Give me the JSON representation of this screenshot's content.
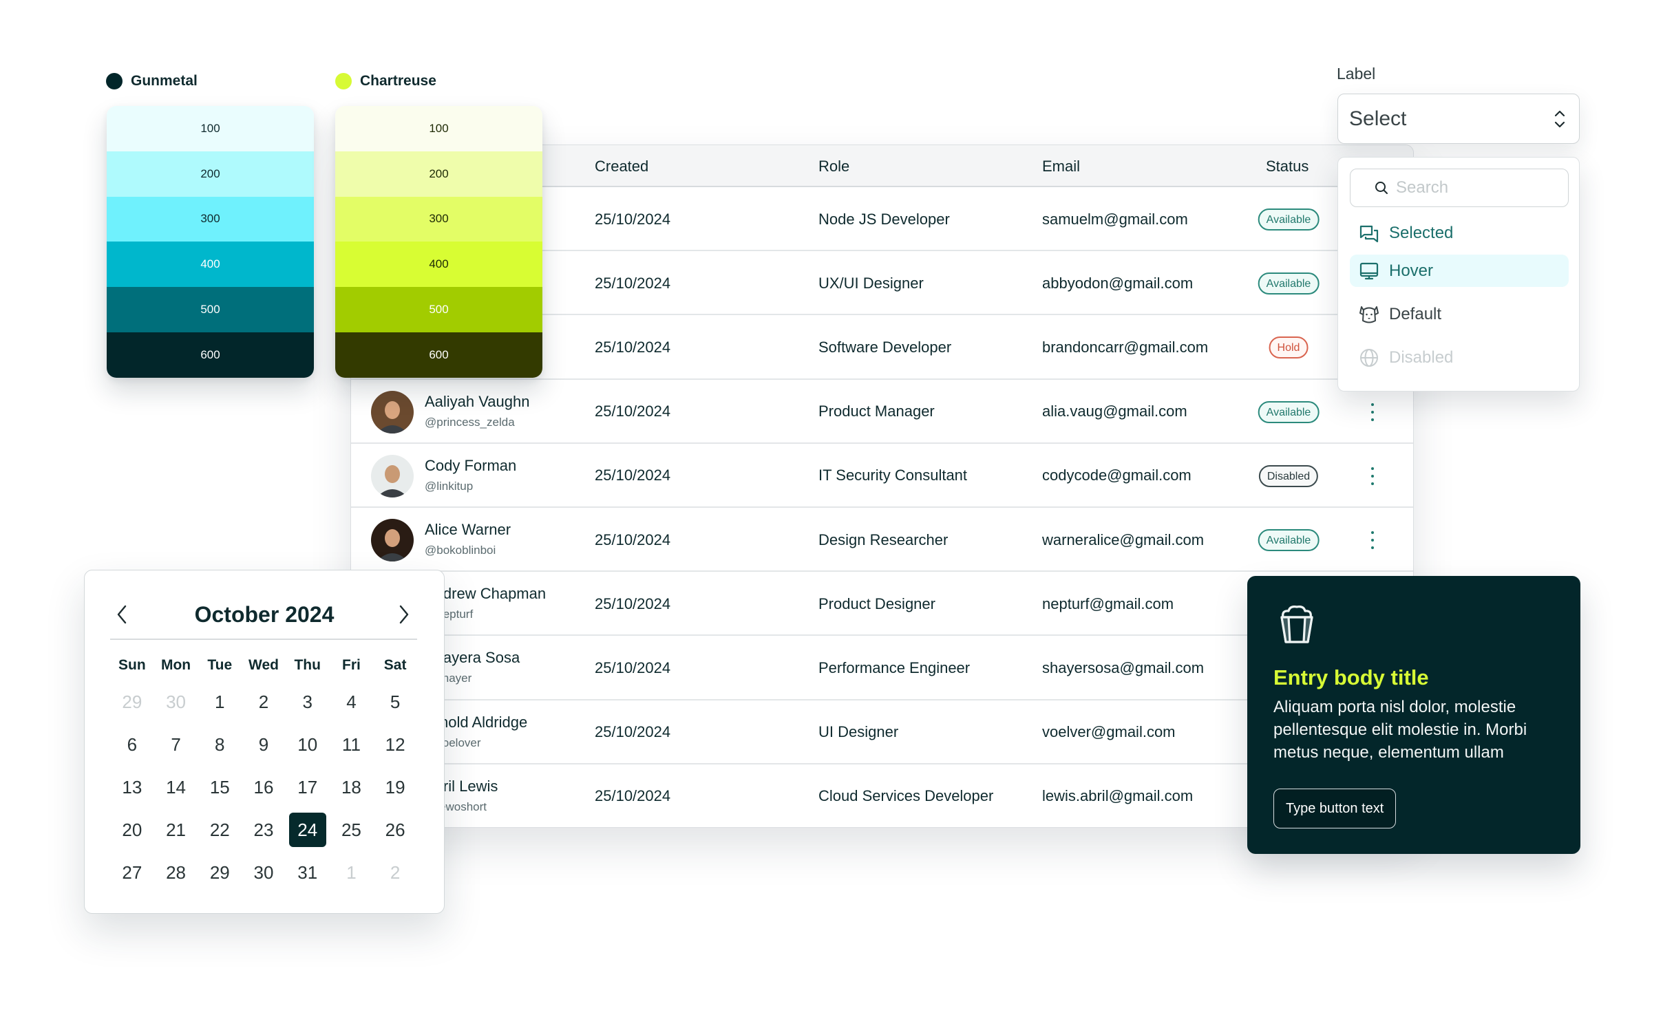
{
  "palettes": [
    {
      "name": "Gunmetal",
      "dot_color": "#02262a",
      "swatches": [
        {
          "label": "100",
          "color": "#eafdfe",
          "text_color": "#0f2a2e"
        },
        {
          "label": "200",
          "color": "#affafd",
          "text_color": "#0f2a2e"
        },
        {
          "label": "300",
          "color": "#6ff1fd",
          "text_color": "#0f2a2e"
        },
        {
          "label": "400",
          "color": "#00b7cc",
          "text_color": "#ffffff"
        },
        {
          "label": "500",
          "color": "#006f7b",
          "text_color": "#ffffff"
        },
        {
          "label": "600",
          "color": "#02262a",
          "text_color": "#ffffff"
        }
      ]
    },
    {
      "name": "Chartreuse",
      "dot_color": "#d7fa35",
      "swatches": [
        {
          "label": "100",
          "color": "#fbfdee",
          "text_color": "#1e2a05"
        },
        {
          "label": "200",
          "color": "#effdab",
          "text_color": "#1e2a05"
        },
        {
          "label": "300",
          "color": "#e3fd66",
          "text_color": "#1e2a05"
        },
        {
          "label": "400",
          "color": "#d8fd33",
          "text_color": "#1e2a05"
        },
        {
          "label": "500",
          "color": "#a2cc00",
          "text_color": "#ffffff"
        },
        {
          "label": "600",
          "color": "#333a00",
          "text_color": "#ffffff"
        }
      ]
    }
  ],
  "table": {
    "columns": {
      "created": "Created",
      "role": "Role",
      "email": "Email",
      "status": "Status"
    },
    "rows": [
      {
        "name": "",
        "handle": "",
        "created": "25/10/2024",
        "role": "Node JS Developer",
        "email": "samuelm@gmail.com",
        "status": "Available",
        "status_kind": "available"
      },
      {
        "name": "",
        "handle": "",
        "created": "25/10/2024",
        "role": "UX/UI Designer",
        "email": "abbyodon@gmail.com",
        "status": "Available",
        "status_kind": "available"
      },
      {
        "name": "",
        "handle": "",
        "created": "25/10/2024",
        "role": "Software Developer",
        "email": "brandoncarr@gmail.com",
        "status": "Hold",
        "status_kind": "hold"
      },
      {
        "name": "Aaliyah Vaughn",
        "handle": "@princess_zelda",
        "created": "25/10/2024",
        "role": "Product Manager",
        "email": "alia.vaug@gmail.com",
        "status": "Available",
        "status_kind": "available",
        "avatar_bg": "#6b4a2f",
        "avatar_skin": "#d9a57f"
      },
      {
        "name": "Cody Forman",
        "handle": "@linkitup",
        "created": "25/10/2024",
        "role": "IT Security Consultant",
        "email": "codycode@gmail.com",
        "status": "Disabled",
        "status_kind": "disabled",
        "avatar_bg": "#e8ecec",
        "avatar_skin": "#c99a74"
      },
      {
        "name": "Alice Warner",
        "handle": "@bokoblinboi",
        "created": "25/10/2024",
        "role": "Design Researcher",
        "email": "warneralice@gmail.com",
        "status": "Available",
        "status_kind": "available",
        "avatar_bg": "#2a1c14",
        "avatar_skin": "#d3a07c"
      },
      {
        "name": "Andrew Chapman",
        "handle": "@nepturf",
        "created": "25/10/2024",
        "role": "Product Designer",
        "email": "nepturf@gmail.com",
        "status": "",
        "status_kind": ""
      },
      {
        "name": "Shayera Sosa",
        "handle": "@shayer",
        "created": "25/10/2024",
        "role": "Performance Engineer",
        "email": "shayersosa@gmail.com",
        "status": "",
        "status_kind": ""
      },
      {
        "name": "Arnold Aldridge",
        "handle": "@voelover",
        "created": "25/10/2024",
        "role": "UI Designer",
        "email": "voelver@gmail.com",
        "status": "",
        "status_kind": ""
      },
      {
        "name": "Abril Lewis",
        "handle": "@lewoshort",
        "created": "25/10/2024",
        "role": "Cloud Services Developer",
        "email": "lewis.abril@gmail.com",
        "status": "",
        "status_kind": ""
      }
    ]
  },
  "select": {
    "label": "Label",
    "value": "Select",
    "search_placeholder": "Search",
    "options": [
      {
        "label": "Selected",
        "state": "selected",
        "icon": "chat-bubbles-icon"
      },
      {
        "label": "Hover",
        "state": "hover",
        "icon": "monitor-icon"
      },
      {
        "label": "Default",
        "state": "default",
        "icon": "dog-icon"
      },
      {
        "label": "Disabled",
        "state": "disabled",
        "icon": "globe-icon"
      }
    ]
  },
  "calendar": {
    "title": "October 2024",
    "weekdays": [
      "Sun",
      "Mon",
      "Tue",
      "Wed",
      "Thu",
      "Fri",
      "Sat"
    ],
    "weeks": [
      [
        {
          "d": "29",
          "muted": true
        },
        {
          "d": "30",
          "muted": true
        },
        {
          "d": "1"
        },
        {
          "d": "2"
        },
        {
          "d": "3"
        },
        {
          "d": "4"
        },
        {
          "d": "5"
        }
      ],
      [
        {
          "d": "6"
        },
        {
          "d": "7"
        },
        {
          "d": "8"
        },
        {
          "d": "9"
        },
        {
          "d": "10"
        },
        {
          "d": "11"
        },
        {
          "d": "12"
        }
      ],
      [
        {
          "d": "13"
        },
        {
          "d": "14"
        },
        {
          "d": "15"
        },
        {
          "d": "16"
        },
        {
          "d": "17"
        },
        {
          "d": "18"
        },
        {
          "d": "19"
        }
      ],
      [
        {
          "d": "20"
        },
        {
          "d": "21"
        },
        {
          "d": "22"
        },
        {
          "d": "23"
        },
        {
          "d": "24",
          "selected": true
        },
        {
          "d": "25"
        },
        {
          "d": "26"
        }
      ],
      [
        {
          "d": "27"
        },
        {
          "d": "28"
        },
        {
          "d": "29"
        },
        {
          "d": "30"
        },
        {
          "d": "31"
        },
        {
          "d": "1",
          "muted": true
        },
        {
          "d": "2",
          "muted": true
        }
      ]
    ],
    "selected_day": "24"
  },
  "entry_card": {
    "icon": "popcorn-icon",
    "title": "Entry body title",
    "body": "Aliquam porta nisl dolor, molestie pellentesque elit molestie in. Morbi metus neque, elementum ullam",
    "button_label": "Type button text",
    "accent_color": "#d7fa35",
    "background_color": "#03262a"
  }
}
